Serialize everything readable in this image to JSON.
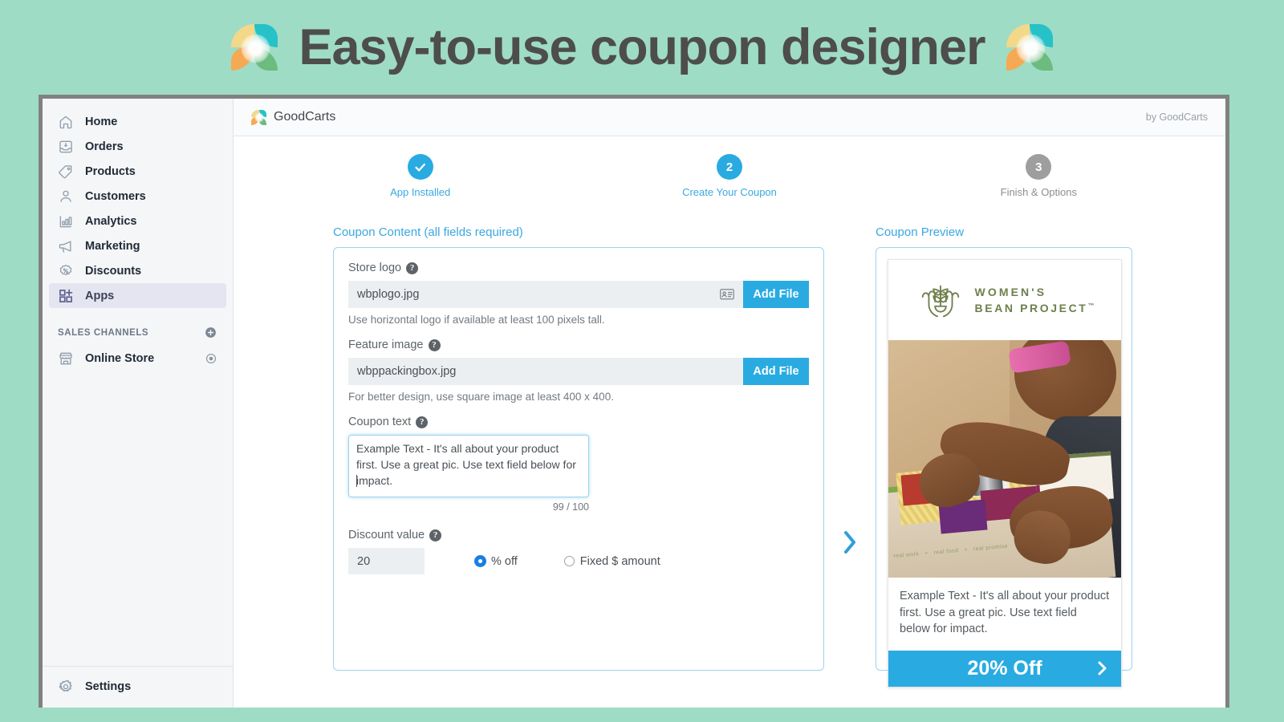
{
  "banner": {
    "title": "Easy-to-use coupon designer",
    "logo_icon_left": "goodcarts-logo-icon",
    "logo_icon_right": "goodcarts-logo-icon",
    "background_color": "#9fdcc5",
    "text_color": "#4d4d4d"
  },
  "sidebar": {
    "items": [
      {
        "label": "Home",
        "icon": "home-icon",
        "active": false
      },
      {
        "label": "Orders",
        "icon": "orders-inbox-icon",
        "active": false
      },
      {
        "label": "Products",
        "icon": "product-tag-icon",
        "active": false
      },
      {
        "label": "Customers",
        "icon": "customer-person-icon",
        "active": false
      },
      {
        "label": "Analytics",
        "icon": "analytics-bar-chart-icon",
        "active": false
      },
      {
        "label": "Marketing",
        "icon": "marketing-megaphone-icon",
        "active": false
      },
      {
        "label": "Discounts",
        "icon": "discount-percent-badge-icon",
        "active": false
      },
      {
        "label": "Apps",
        "icon": "apps-grid-plus-icon",
        "active": true
      }
    ],
    "section_header": "SALES CHANNELS",
    "section_add_icon": "plus-circle-icon",
    "channels": [
      {
        "label": "Online Store",
        "icon": "storefront-icon",
        "action_icon": "eye-icon"
      }
    ],
    "settings": {
      "label": "Settings",
      "icon": "gear-icon"
    },
    "active_highlight_color": "#e4e5f0"
  },
  "appbar": {
    "app_icon": "goodcarts-logo-icon",
    "app_name": "GoodCarts",
    "by_line": "by GoodCarts"
  },
  "steps": [
    {
      "label": "App Installed",
      "badge": "✓",
      "state": "done"
    },
    {
      "label": "Create Your Coupon",
      "badge": "2",
      "state": "current"
    },
    {
      "label": "Finish & Options",
      "badge": "3",
      "state": "todo"
    }
  ],
  "form": {
    "section_title": "Coupon Content (all fields required)",
    "store_logo": {
      "label": "Store logo",
      "help_icon": "help-question-icon",
      "value": "wbplogo.jpg",
      "inline_icon": "contact-card-icon",
      "button": "Add File",
      "hint": "Use horizontal logo if available at least 100 pixels tall."
    },
    "feature_image": {
      "label": "Feature image",
      "help_icon": "help-question-icon",
      "value": "wbppackingbox.jpg",
      "button": "Add File",
      "hint": "For better design, use square image at least 400 x 400."
    },
    "coupon_text": {
      "label": "Coupon text",
      "help_icon": "help-question-icon",
      "value": "Example Text - It's all about your product first. Use a great pic. Use text field below for impact.",
      "counter": "99 / 100"
    },
    "discount": {
      "label": "Discount value",
      "help_icon": "help-question-icon",
      "value": "20",
      "options": [
        {
          "label": "% off",
          "selected": true
        },
        {
          "label": "Fixed $ amount",
          "selected": false
        }
      ]
    },
    "accent_color": "#29abe2",
    "panel_border_color": "#9ed3ee"
  },
  "divider_icon": "chevron-right-icon",
  "preview": {
    "section_title": "Coupon Preview",
    "logo": {
      "icon": "women-bean-project-hands-plant-icon",
      "line1": "WOMEN'S",
      "line2": "BEAN PROJECT",
      "trademark": "™",
      "color": "#6f7f4c"
    },
    "photo": {
      "alt_name": "packing-box-photo",
      "box_text": [
        "real work",
        "+",
        "real food",
        "+",
        "real promise"
      ]
    },
    "body_text": "Example Text - It's all about your product first. Use a great pic. Use text field below for impact.",
    "cta": {
      "text": "20% Off",
      "chevron_icon": "chevron-right-icon",
      "background": "#29abe2"
    }
  }
}
